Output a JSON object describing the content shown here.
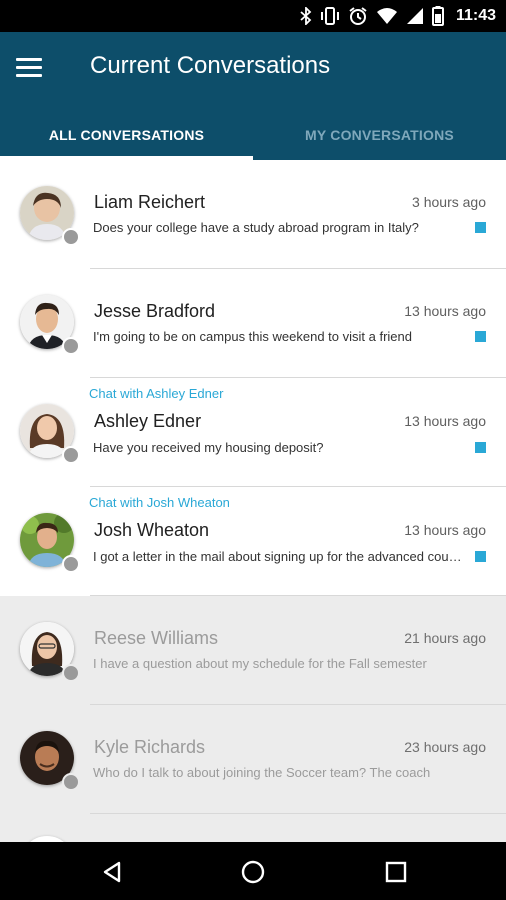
{
  "status_bar": {
    "time": "11:43",
    "icons": [
      "bluetooth-icon",
      "vibrate-icon",
      "alarm-icon",
      "wifi-icon",
      "signal-icon",
      "battery-icon"
    ]
  },
  "app_bar": {
    "title": "Current Conversations",
    "menu_icon": "hamburger-menu-icon",
    "color": "#0d4e6a"
  },
  "tabs": [
    {
      "label": "ALL CONVERSATIONS",
      "active": true
    },
    {
      "label": "MY CONVERSATIONS",
      "active": false
    }
  ],
  "accent_color": "#2aa8d6",
  "conversations": [
    {
      "chat_with": "",
      "name": "Liam Reichert",
      "time": "3 hours ago",
      "message": "Does your college have a study abroad program in Italy?",
      "unread": true
    },
    {
      "chat_with": "",
      "name": "Jesse Bradford",
      "time": "13 hours ago",
      "message": "I'm going to be on campus this weekend to visit a friend",
      "unread": true
    },
    {
      "chat_with": "Chat with Ashley Edner",
      "name": "Ashley Edner",
      "time": "13 hours ago",
      "message": "Have you received my housing deposit?",
      "unread": true
    },
    {
      "chat_with": "Chat with Josh Wheaton",
      "name": "Josh Wheaton",
      "time": "13 hours ago",
      "message": "I got a letter in the mail about signing up for the advanced course",
      "unread": true
    },
    {
      "chat_with": "",
      "name": "Reese Williams",
      "time": "21 hours ago",
      "message": "I have a question about my schedule for the Fall semester",
      "unread": false
    },
    {
      "chat_with": "",
      "name": "Kyle Richards",
      "time": "23 hours ago",
      "message": "Who do I talk to about joining the Soccer team? The coach",
      "unread": false
    }
  ],
  "nav_bar": {
    "icons": [
      "back-icon",
      "home-icon",
      "recents-icon"
    ]
  }
}
